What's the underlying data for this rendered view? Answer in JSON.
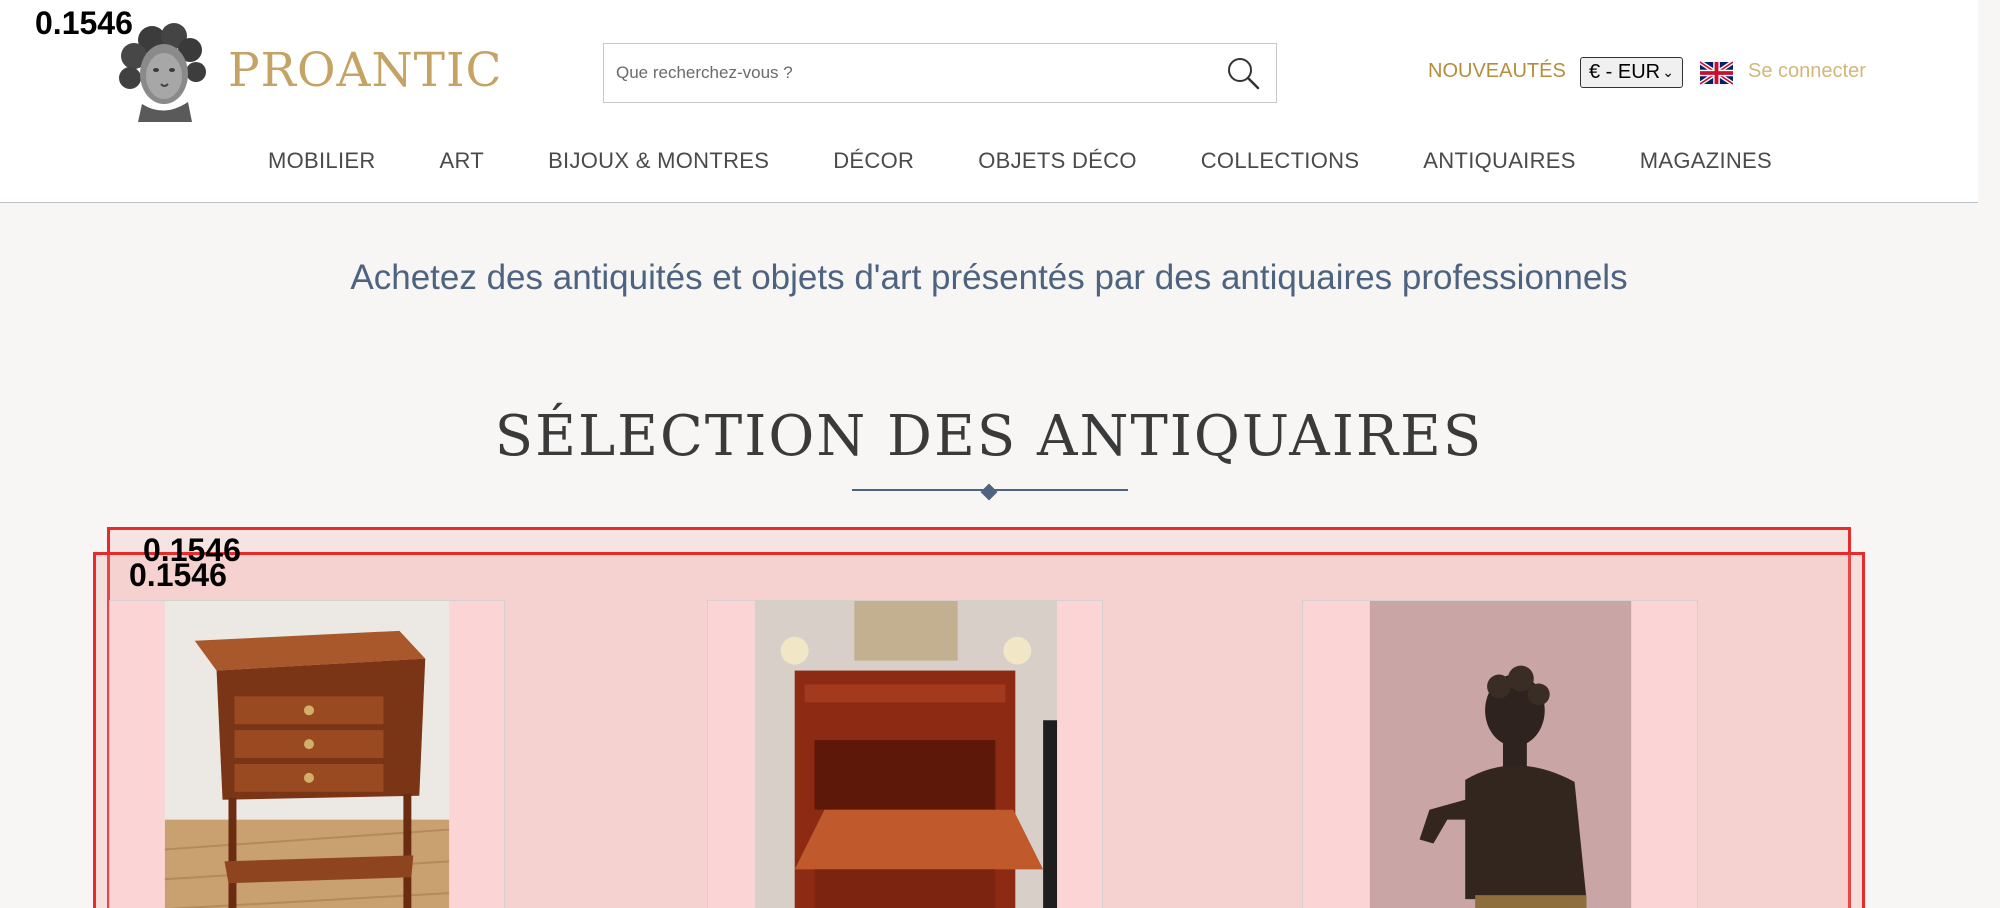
{
  "header": {
    "brand": "PROANTIC",
    "search_placeholder": "Que recherchez-vous ?",
    "new_link": "NOUVEAUTÉS",
    "currency": "€ - EUR",
    "login": "Se connecter"
  },
  "nav": {
    "items": [
      "MOBILIER",
      "ART",
      "BIJOUX & MONTRES",
      "DÉCOR",
      "OBJETS DÉCO",
      "COLLECTIONS",
      "ANTIQUAIRES",
      "MAGAZINES"
    ]
  },
  "main": {
    "tagline": "Achetez des antiquités et objets d'art présentés par des antiquaires professionnels",
    "section_title": "SÉLECTION DES ANTIQUAIRES"
  },
  "overlays": {
    "score_top": "0.1546",
    "score_box_outer": "0.1546",
    "score_box_inner": "0.1546"
  },
  "colors": {
    "brand_gold": "#c4a364",
    "nav_blue": "#4d6380",
    "overlay_red": "#e52b2b"
  }
}
